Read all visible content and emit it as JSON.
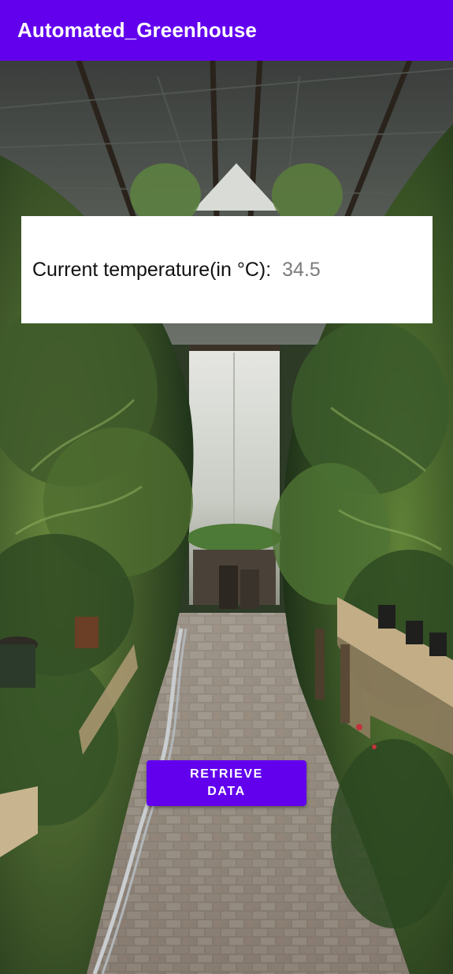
{
  "app_bar": {
    "title": "Automated_Greenhouse",
    "background_color": "#6200ee"
  },
  "temperature_card": {
    "label": "Current temperature(in °C):",
    "value": "34.5"
  },
  "retrieve_button": {
    "label": "RETRIEVE DATA",
    "background_color": "#6200ee"
  },
  "background": {
    "description_icon": "greenhouse-photo"
  }
}
